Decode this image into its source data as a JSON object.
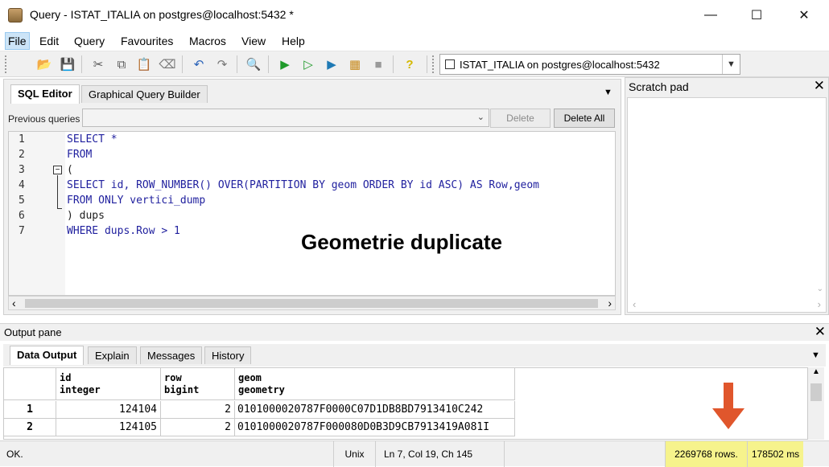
{
  "window": {
    "title": "Query - ISTAT_ITALIA on postgres@localhost:5432 *",
    "minimize": "—",
    "maximize": "☐",
    "close": "✕"
  },
  "menu": [
    "File",
    "Edit",
    "Query",
    "Favourites",
    "Macros",
    "View",
    "Help"
  ],
  "toolbar": {
    "connection": "ISTAT_ITALIA on postgres@localhost:5432",
    "icons": [
      "open-icon",
      "save-icon",
      "cut-icon",
      "copy-icon",
      "paste-icon",
      "clear-icon",
      "undo-icon",
      "redo-icon",
      "find-icon",
      "execute-icon",
      "execute-pgscript-icon",
      "execute-to-file-icon",
      "explain-icon",
      "stop-icon",
      "help-icon"
    ]
  },
  "editor": {
    "tabs": [
      "SQL Editor",
      "Graphical Query Builder"
    ],
    "previous_queries_label": "Previous queries",
    "delete_label": "Delete",
    "delete_all_label": "Delete All",
    "line_numbers": [
      "1",
      "2",
      "3",
      "4",
      "5",
      "6",
      "7"
    ],
    "code_lines": [
      "SELECT *",
      "FROM",
      "(",
      "SELECT id, ROW_NUMBER() OVER(PARTITION BY geom ORDER BY id ASC) AS Row,geom",
      "FROM ONLY vertici_dump",
      ") dups",
      "WHERE dups.Row > 1"
    ]
  },
  "overlay_title": "Geometrie duplicate",
  "scratch_pad": {
    "title": "Scratch pad",
    "close": "✕"
  },
  "output": {
    "title": "Output pane",
    "close": "✕",
    "tabs": [
      "Data Output",
      "Explain",
      "Messages",
      "History"
    ],
    "columns": [
      {
        "name": "id",
        "type": "integer"
      },
      {
        "name": "row",
        "type": "bigint"
      },
      {
        "name": "geom",
        "type": "geometry"
      }
    ],
    "rows": [
      {
        "num": "1",
        "id": "124104",
        "row": "2",
        "geom": "0101000020787F0000C07D1DB8BD7913410C242"
      },
      {
        "num": "2",
        "id": "124105",
        "row": "2",
        "geom": "0101000020787F000080D0B3D9CB7913419A081I"
      }
    ]
  },
  "status": {
    "message": "OK.",
    "line_ending": "Unix",
    "cursor": "Ln 7, Col 19, Ch 145",
    "rows": "2269768 rows.",
    "time": "178502 ms"
  },
  "colors": {
    "arrow": "#e0562c",
    "highlight": "#f6f38c",
    "keyword": "#1f1f9e"
  }
}
